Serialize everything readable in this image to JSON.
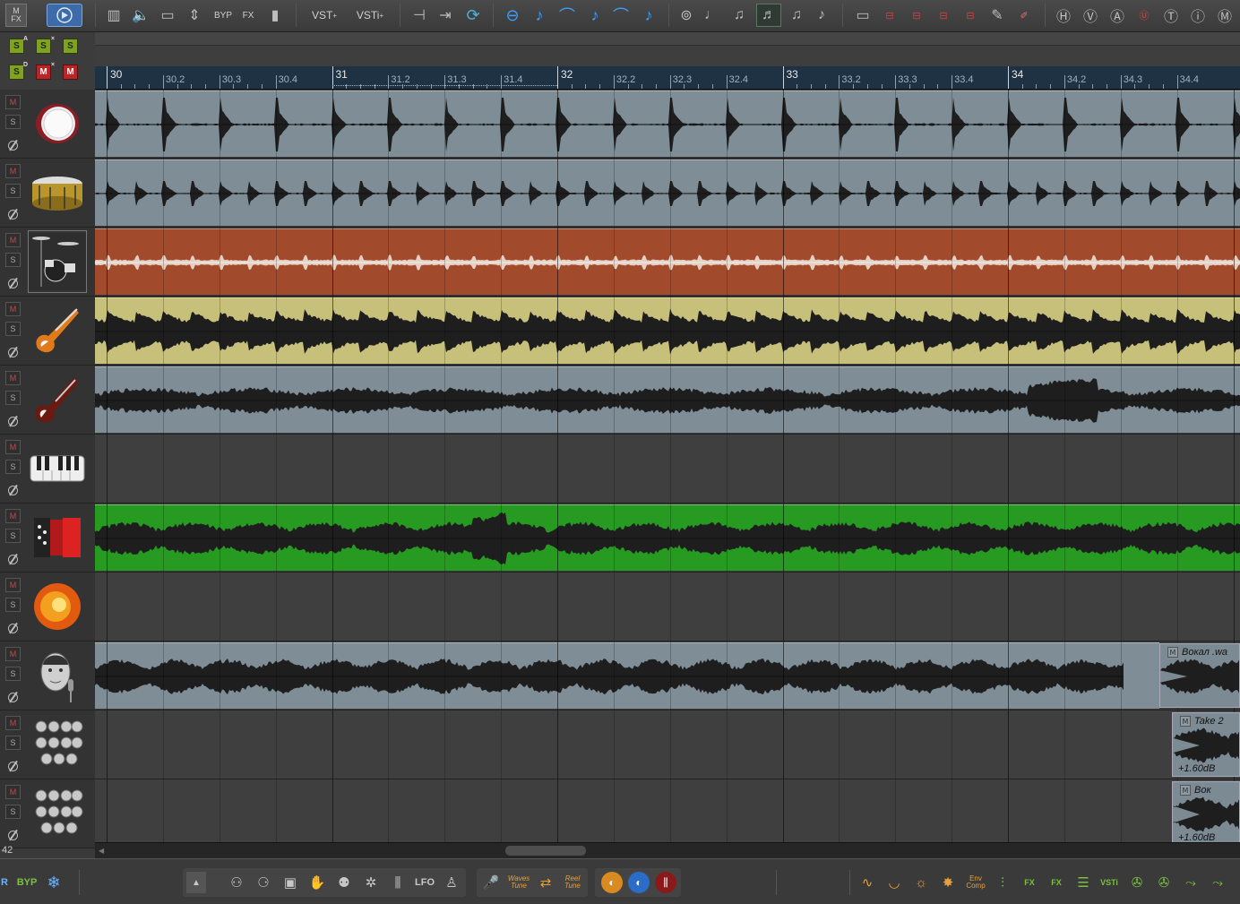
{
  "colors": {
    "lane_gray": "#7e8d96",
    "lane_rust": "#a24a2c",
    "lane_olive": "#c7c07a",
    "lane_green": "#279a22",
    "ruler_bg": "#1e3244",
    "solo_green": "#7fa321",
    "mute_red": "#b8262a"
  },
  "toolbar": {
    "mfx_label": "M\nFX",
    "byp_label": "BYP",
    "fx_label": "FX",
    "vst_label": "VST",
    "vsti_label": "VSTi",
    "vst_sup": "+",
    "vsti_sup": "+"
  },
  "global_buttons": {
    "solo_a": "S",
    "solo_a_sup": "A",
    "solo_x": "S",
    "solo_x_sup": "×",
    "solo": "S",
    "solo_d": "S",
    "solo_d_sup": "D",
    "mute_x": "M",
    "mute_x_sup": "×",
    "mute": "M"
  },
  "ruler": {
    "bars": [
      "30",
      "31",
      "32",
      "33",
      "34"
    ],
    "beats": [
      [
        "30.2",
        "30.3",
        "30.4"
      ],
      [
        "31.2",
        "31.3",
        "31.4"
      ],
      [
        "32.2",
        "32.3",
        "32.4"
      ],
      [
        "33.2",
        "33.3",
        "33.4"
      ],
      [
        "34.2",
        "34.3",
        "34.4"
      ]
    ]
  },
  "tracks": [
    {
      "name": "kick-drum",
      "icon": "bass-drum-icon",
      "lane": "lane_gray",
      "wave": "hits",
      "mute": "M",
      "solo": "S"
    },
    {
      "name": "snare-drum",
      "icon": "snare-drum-icon",
      "lane": "lane_gray",
      "wave": "snare",
      "mute": "M",
      "solo": "S"
    },
    {
      "name": "drum-kit",
      "icon": "drum-kit-icon",
      "lane": "lane_rust",
      "wave": "light",
      "mute": "M",
      "solo": "S",
      "selected": true
    },
    {
      "name": "bass-guitar",
      "icon": "bass-guitar-icon",
      "lane": "lane_olive",
      "wave": "dense",
      "mute": "M",
      "solo": "S"
    },
    {
      "name": "electric-guitar",
      "icon": "electric-guitar-icon",
      "lane": "lane_gray",
      "wave": "guitar",
      "mute": "M",
      "solo": "S"
    },
    {
      "name": "piano",
      "icon": "piano-keys-icon",
      "lane": null,
      "wave": null,
      "mute": "M",
      "solo": "S"
    },
    {
      "name": "accordion",
      "icon": "accordion-icon",
      "lane": "lane_green",
      "wave": "accordion",
      "mute": "M",
      "solo": "S"
    },
    {
      "name": "fx-explosion",
      "icon": "explosion-icon",
      "lane": null,
      "wave": null,
      "mute": "M",
      "solo": "S"
    },
    {
      "name": "lead-vocal",
      "icon": "singer-face-icon",
      "lane": "lane_gray",
      "wave": "vocal",
      "mute": "M",
      "solo": "S",
      "clip_end": 1148
    },
    {
      "name": "choir-1",
      "icon": "choir-icon",
      "lane": null,
      "wave": null,
      "mute": "M",
      "solo": "S"
    },
    {
      "name": "choir-2",
      "icon": "choir-icon",
      "lane": null,
      "wave": null,
      "mute": "M",
      "solo": "S"
    }
  ],
  "takes": [
    {
      "label": "Вокал .wa",
      "m": "M",
      "gain": ""
    },
    {
      "label": "Take 2",
      "m": "M",
      "gain": "+1.60dB"
    },
    {
      "label": "Вок",
      "m": "M",
      "gain": "+1.60dB"
    }
  ],
  "counter": "42",
  "bottombar": {
    "r_label": "R",
    "byp_label": "BYP",
    "snowflake_icon": "❄",
    "lfo_label": "LFO",
    "waves_tune": "Waves\nTune",
    "reel_tune": "Reel\nTune",
    "env_comp": "Env\nComp",
    "fx_label": "FX",
    "vsti_label": "VSTi"
  }
}
